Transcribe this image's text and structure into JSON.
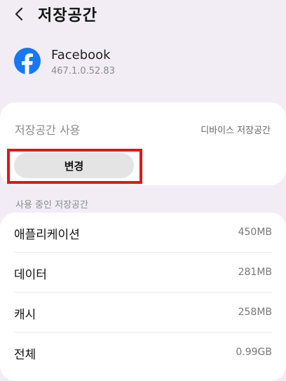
{
  "header": {
    "title": "저장공간",
    "back_icon": "chevron-left-icon"
  },
  "app": {
    "name": "Facebook",
    "version": "467.1.0.52.83",
    "icon": "facebook-icon",
    "brand_color": "#1877f2"
  },
  "storage_card": {
    "usage_label": "저장공간 사용",
    "location": "디바이스 저장공간",
    "change_button": "변경"
  },
  "highlight_color": "#e0151c",
  "used_storage": {
    "section_label": "사용 중인 저장공간",
    "rows": [
      {
        "label": "애플리케이션",
        "value": "450MB"
      },
      {
        "label": "데이터",
        "value": "281MB"
      },
      {
        "label": "캐시",
        "value": "258MB"
      },
      {
        "label": "전체",
        "value": "0.99GB"
      }
    ]
  }
}
